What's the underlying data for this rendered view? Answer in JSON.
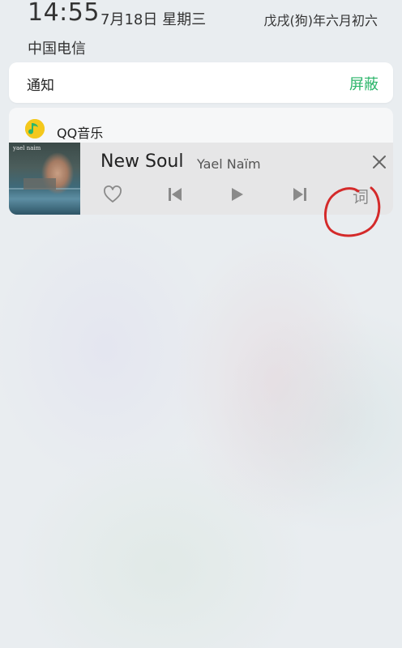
{
  "status_bar": {
    "time": "14:55",
    "date": "7月18日 星期三",
    "lunar_date": "戊戌(狗)年六月初六",
    "carrier": "中国电信"
  },
  "notification_header": {
    "title": "通知",
    "block_label": "屏蔽"
  },
  "music_notification": {
    "app_name": "QQ音乐",
    "album_text": "yael naim",
    "song_title": "New Soul",
    "artist": "Yael Naïm",
    "controls": {
      "favorite_icon": "heart-icon",
      "previous_icon": "skip-previous-icon",
      "play_icon": "play-icon",
      "next_icon": "skip-next-icon",
      "lyrics_label": "词",
      "close_icon": "close-icon"
    }
  },
  "colors": {
    "accent_green": "#2bb56a",
    "qq_music_yellow": "#f4c81c",
    "annotation_red": "#d42a2a"
  }
}
